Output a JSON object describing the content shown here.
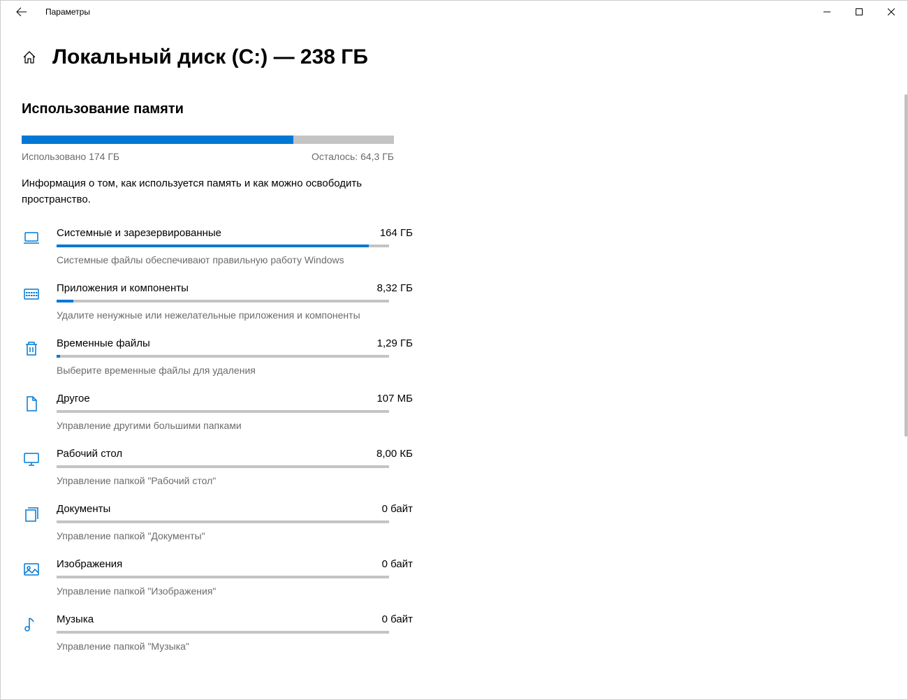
{
  "titlebar": {
    "title": "Параметры"
  },
  "page": {
    "title": "Локальный диск (C:) — 238 ГБ"
  },
  "section": {
    "title": "Использование памяти"
  },
  "overall": {
    "used_label": "Использовано 174 ГБ",
    "free_label": "Осталось: 64,3 ГБ",
    "fill_pct": 73
  },
  "info_text": "Информация о том, как используется память и как можно освободить пространство.",
  "categories": [
    {
      "icon": "laptop",
      "title": "Системные и зарезервированные",
      "size": "164 ГБ",
      "fill_pct": 94,
      "desc": "Системные файлы обеспечивают правильную работу Windows"
    },
    {
      "icon": "apps",
      "title": "Приложения и компоненты",
      "size": "8,32 ГБ",
      "fill_pct": 5,
      "desc": "Удалите ненужные или нежелательные приложения и компоненты"
    },
    {
      "icon": "trash",
      "title": "Временные файлы",
      "size": "1,29 ГБ",
      "fill_pct": 1,
      "desc": "Выберите временные файлы для удаления"
    },
    {
      "icon": "file",
      "title": "Другое",
      "size": "107 МБ",
      "fill_pct": 0,
      "desc": "Управление другими большими папками"
    },
    {
      "icon": "desktop",
      "title": "Рабочий стол",
      "size": "8,00 КБ",
      "fill_pct": 0,
      "desc": "Управление папкой \"Рабочий стол\""
    },
    {
      "icon": "documents",
      "title": "Документы",
      "size": "0 байт",
      "fill_pct": 0,
      "desc": "Управление папкой \"Документы\""
    },
    {
      "icon": "pictures",
      "title": "Изображения",
      "size": "0 байт",
      "fill_pct": 0,
      "desc": "Управление папкой \"Изображения\""
    },
    {
      "icon": "music",
      "title": "Музыка",
      "size": "0 байт",
      "fill_pct": 0,
      "desc": "Управление папкой \"Музыка\""
    }
  ]
}
